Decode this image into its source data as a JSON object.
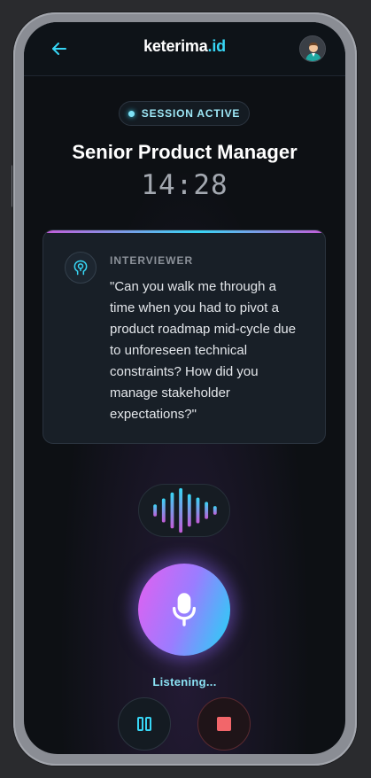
{
  "header": {
    "brand_main": "keterima",
    "brand_accent": ".id",
    "back_icon": "arrow-left-icon",
    "avatar_icon": "user-avatar-icon"
  },
  "session": {
    "status": "SESSION ACTIVE",
    "role": "Senior Product Manager",
    "timer": "14:28"
  },
  "card": {
    "label": "INTERVIEWER",
    "question": "\"Can you walk me through a time when you had to pivot a product roadmap mid-cycle due to unforeseen technical constraints? How did you manage stakeholder expectations?\"",
    "icon": "ai-head-icon"
  },
  "controls": {
    "listening": "Listening...",
    "mic_icon": "microphone-icon",
    "pause_icon": "pause-icon",
    "stop_icon": "stop-icon"
  },
  "colors": {
    "accent_cyan": "#37d6f5",
    "accent_pink": "#e45ff0",
    "stop_red": "#f2666a"
  }
}
